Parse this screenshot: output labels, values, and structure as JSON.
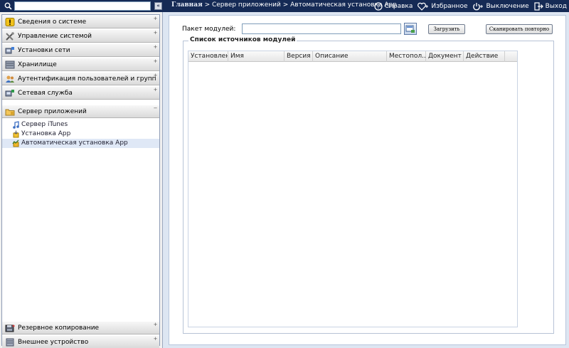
{
  "topbar": {
    "search_value": "",
    "collapse_glyph": "«",
    "breadcrumb": {
      "home": "Главная",
      "sep1": " > ",
      "section": "Сервер приложений",
      "sep2": " > ",
      "page": "Автоматическая установка App"
    },
    "actions": [
      {
        "label": "Справка",
        "icon": "help-icon"
      },
      {
        "label": "Избранное",
        "icon": "heart-icon"
      },
      {
        "label": "Выключение",
        "icon": "power-icon"
      },
      {
        "label": "Выход",
        "icon": "logout-icon"
      }
    ]
  },
  "sidebar": {
    "sections": [
      {
        "label": "Сведения о системе",
        "icon": "info-icon",
        "toggle": "+"
      },
      {
        "label": "Управление системой",
        "icon": "tools-icon",
        "toggle": "+"
      },
      {
        "label": "Установки сети",
        "icon": "network-icon",
        "toggle": "+"
      },
      {
        "label": "Хранилище",
        "icon": "storage-icon",
        "toggle": "+"
      },
      {
        "label": "Аутентификация пользователей и групп",
        "icon": "users-icon",
        "toggle": "+"
      },
      {
        "label": "Сетевая служба",
        "icon": "network-service-icon",
        "toggle": "+"
      },
      {
        "label": "Сервер приложений",
        "icon": "folder-icon",
        "toggle": "−"
      }
    ],
    "subitems": [
      {
        "label": "Сервер iTunes",
        "icon": "music-note-icon"
      },
      {
        "label": "Установка App",
        "icon": "install-app-icon"
      },
      {
        "label": "Автоматическая установка App",
        "icon": "auto-install-icon"
      }
    ],
    "bottom_sections": [
      {
        "label": "Резервное копирование",
        "icon": "backup-icon",
        "toggle": "+"
      },
      {
        "label": "Внешнее устройство",
        "icon": "external-device-icon",
        "toggle": "+"
      }
    ]
  },
  "main": {
    "package_label": "Пакет модулей:",
    "package_value": "",
    "upload_button": "Загрузить",
    "rescan_button": "Сканировать повторно",
    "list_title": "Список источников модулей",
    "columns": [
      "Установлен",
      "Имя",
      "Версия",
      "Описание",
      "Местопол...",
      "Документ",
      "Действие"
    ],
    "rows": []
  },
  "colors": {
    "topbar": "#152a55",
    "content_bg": "#dde6f2",
    "active_item": "#dfe8f6"
  }
}
